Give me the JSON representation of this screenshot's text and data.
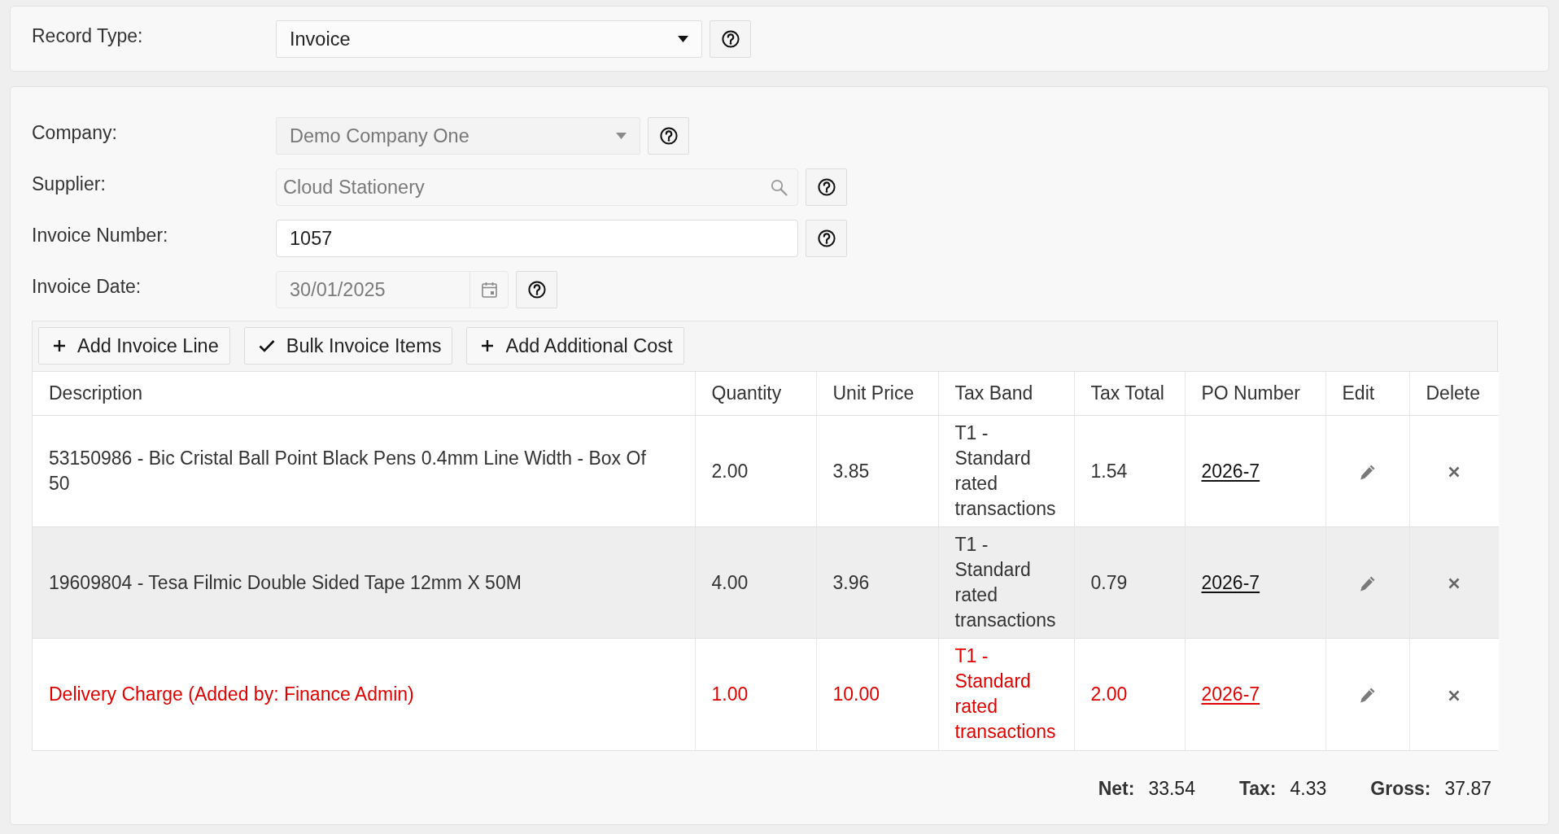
{
  "record_type": {
    "label": "Record Type:",
    "value": "Invoice",
    "disabled": false
  },
  "form": {
    "fields": [
      {
        "kind": "select",
        "label": "Company:",
        "value": "Demo Company One",
        "disabled": true
      },
      {
        "kind": "search",
        "label": "Supplier:",
        "value": "Cloud Stationery",
        "disabled": true
      },
      {
        "kind": "text",
        "label": "Invoice Number:",
        "value": "1057",
        "disabled": false
      },
      {
        "kind": "date",
        "label": "Invoice Date:",
        "value": "30/01/2025",
        "disabled": true
      }
    ]
  },
  "toolbar": [
    {
      "kind": "add",
      "label": "Add Invoice Line"
    },
    {
      "kind": "bulk",
      "label": "Bulk Invoice Items"
    },
    {
      "kind": "add",
      "label": "Add Additional Cost"
    }
  ],
  "table": {
    "columns": [
      "Description",
      "Quantity",
      "Unit Price",
      "Tax Band",
      "Tax Total",
      "PO Number",
      "Edit",
      "Delete"
    ],
    "rows": [
      {
        "kind": "line",
        "highlighted": false,
        "description": "53150986 - Bic Cristal Ball Point Black Pens 0.4mm Line Width - Box Of 50",
        "quantity": "2.00",
        "unit_price": "3.85",
        "tax_band": "T1 - Standard rated transactions",
        "tax_total": "1.54",
        "po_number": "2026-7"
      },
      {
        "kind": "line",
        "highlighted": true,
        "description": "19609804 - Tesa Filmic Double Sided Tape 12mm X 50M",
        "quantity": "4.00",
        "unit_price": "3.96",
        "tax_band": "T1 - Standard rated transactions",
        "tax_total": "0.79",
        "po_number": "2026-7"
      },
      {
        "kind": "additional",
        "highlighted": false,
        "description": "Delivery Charge (Added by: Finance Admin)",
        "quantity": "1.00",
        "unit_price": "10.00",
        "tax_band": "T1 - Standard rated transactions",
        "tax_total": "2.00",
        "po_number": "2026-7"
      }
    ]
  },
  "totals": [
    {
      "label": "Net:",
      "value": "33.54"
    },
    {
      "label": "Tax:",
      "value": "4.33"
    },
    {
      "label": "Gross:",
      "value": "37.87"
    }
  ]
}
